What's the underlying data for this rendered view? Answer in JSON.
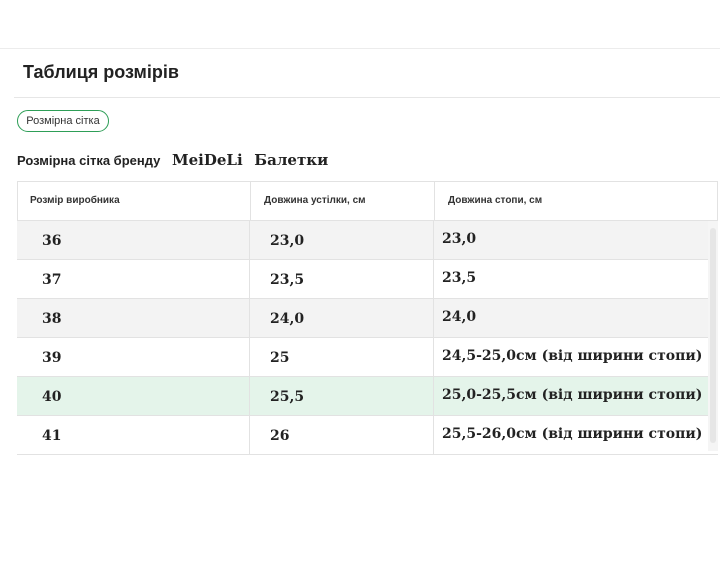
{
  "page": {
    "title": "Таблиця розмірів",
    "tab_label": "Розмірна сітка",
    "brand_prefix": "Розмірна сітка бренду",
    "brand_name": "MeiDeLi",
    "brand_kind": "Балетки"
  },
  "colors": {
    "accent": "#2e9e57",
    "row_alt": "#f3f3f3",
    "row_highlight": "#e4f4ea"
  },
  "table": {
    "headers": [
      "Розмір виробника",
      "Довжина устілки, см",
      "Довжина стопи, см"
    ],
    "rows": [
      [
        "36",
        "23,0",
        "23,0"
      ],
      [
        "37",
        "23,5",
        "23,5"
      ],
      [
        "38",
        "24,0",
        "24,0"
      ],
      [
        "39",
        "25",
        "24,5-25,0см (від ширини стопи)"
      ],
      [
        "40",
        "25,5",
        "25,0-25,5см (від ширини стопи)"
      ],
      [
        "41",
        "26",
        "25,5-26,0см (від ширини стопи)"
      ]
    ]
  }
}
